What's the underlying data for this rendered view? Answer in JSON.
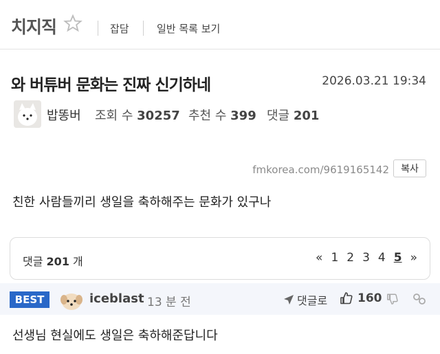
{
  "header": {
    "board_title": "치지직",
    "link_chat": "잡담",
    "link_list": "일반 목록 보기"
  },
  "post": {
    "title": "와 버튜버 문화는 진짜 신기하네",
    "date": "2026.03.21 19:34",
    "author": "밥똥버",
    "views_label": "조회 수",
    "views": "30257",
    "recommend_label": "추천 수",
    "recommend": "399",
    "comments_label": "댓글",
    "comments": "201",
    "short_url": "fmkorea.com/9619165142",
    "copy_label": "복사",
    "content": "친한 사람들끼리 생일을 축하해주는 문화가 있구나"
  },
  "comment_bar": {
    "label": "댓글",
    "count": "201",
    "unit": "개",
    "pages": [
      "«",
      "1",
      "2",
      "3",
      "4",
      "5",
      "»"
    ],
    "current_page": "5"
  },
  "best_comment": {
    "badge": "BEST",
    "author": "iceblast",
    "time": "13 분 전",
    "reply_label": "댓글로",
    "likes": "160",
    "text": "선생님 현실에도 생일은 축하해준답니다"
  },
  "colors": {
    "best_badge": "#2a68c8",
    "best_row_bg": "#f4f6fb"
  }
}
